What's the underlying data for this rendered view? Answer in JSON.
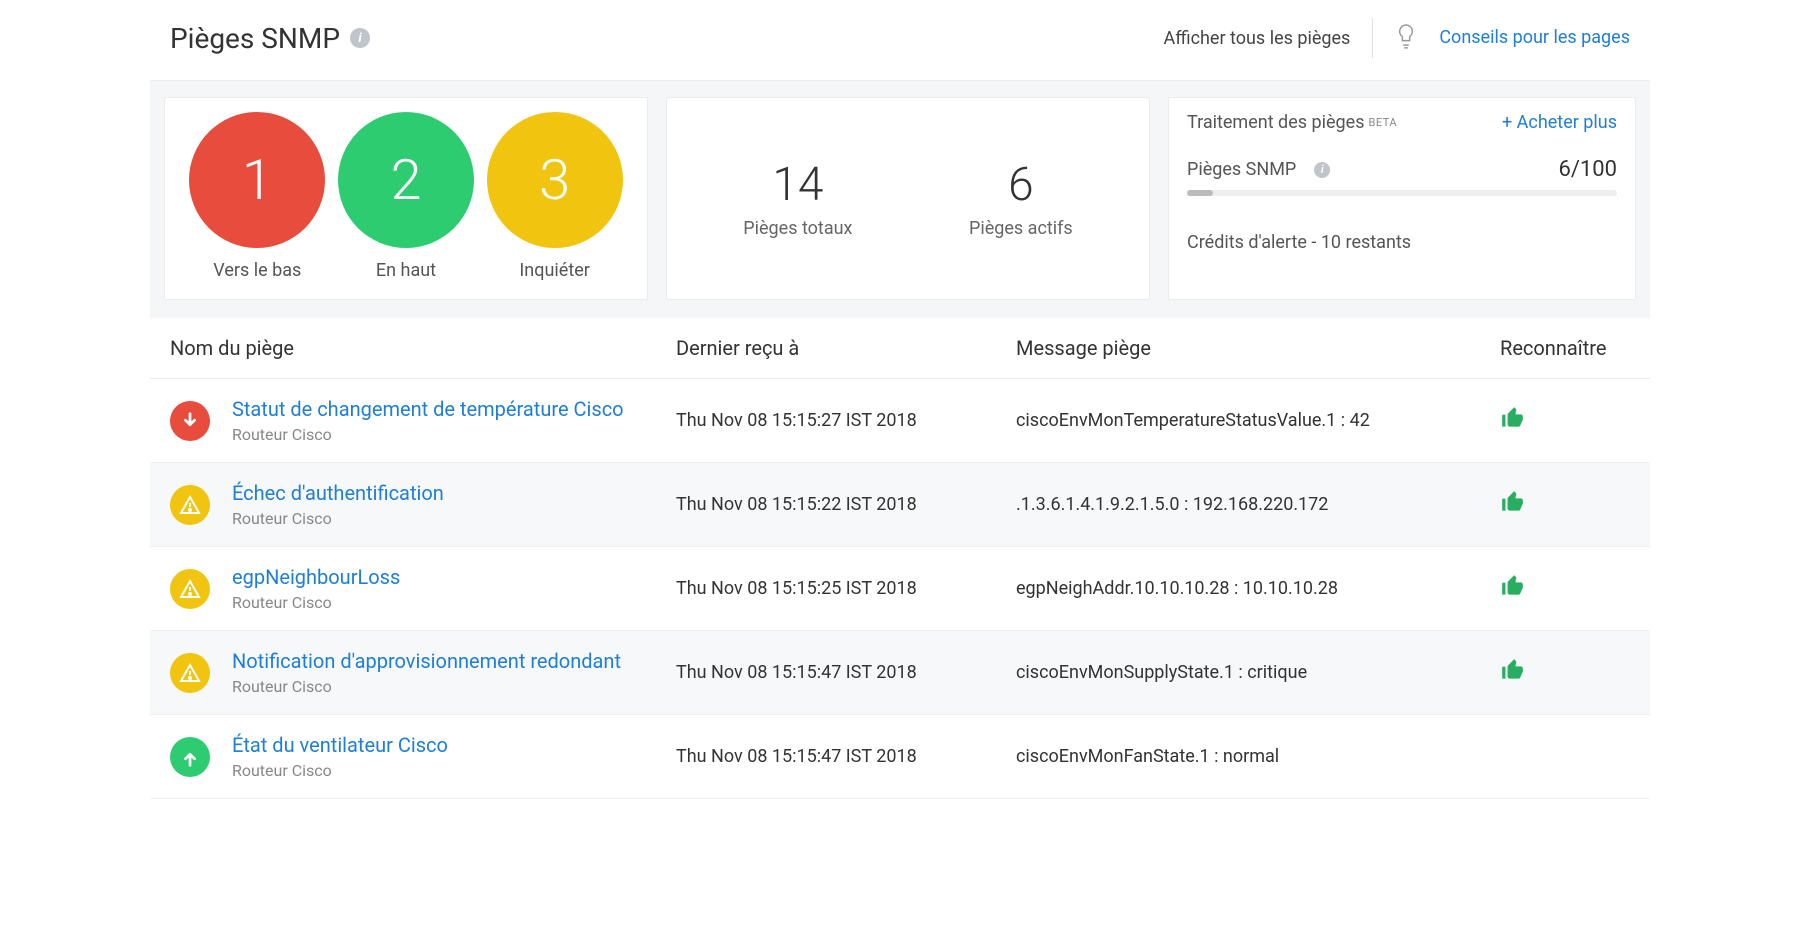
{
  "header": {
    "title": "Pièges SNMP",
    "show_all": "Afficher tous les pièges",
    "tips": "Conseils pour les pages"
  },
  "status_summary": [
    {
      "count": "1",
      "label": "Vers le bas",
      "color": "red"
    },
    {
      "count": "2",
      "label": "En haut",
      "color": "green"
    },
    {
      "count": "3",
      "label": "Inquiéter",
      "color": "yellow"
    }
  ],
  "totals": {
    "total_num": "14",
    "total_lbl": "Pièges totaux",
    "active_num": "6",
    "active_lbl": "Pièges actifs"
  },
  "quota": {
    "title": "Traitement des pièges",
    "beta": "BETA",
    "buy": "+ Acheter plus",
    "metric_label": "Pièges SNMP",
    "metric_value": "6/100",
    "credits": "Crédits d'alerte - 10 restants"
  },
  "columns": {
    "name": "Nom du piège",
    "time": "Dernier reçu à",
    "msg": "Message piège",
    "ack": "Reconnaître"
  },
  "traps": [
    {
      "status": "down",
      "name": "Statut de changement de température Cisco",
      "device": "Routeur Cisco",
      "time": "Thu Nov 08 15:15:27 IST 2018",
      "msg": "ciscoEnvMonTemperatureStatusValue.1 : 42",
      "ack": true,
      "alt": false
    },
    {
      "status": "warn",
      "name": "Échec d'authentification",
      "device": "Routeur Cisco",
      "time": "Thu Nov 08 15:15:22 IST 2018",
      "msg": ".1.3.6.1.4.1.9.2.1.5.0 : 192.168.220.172",
      "ack": true,
      "alt": true
    },
    {
      "status": "warn",
      "name": "egpNeighbourLoss",
      "device": "Routeur Cisco",
      "time": "Thu Nov 08 15:15:25 IST 2018",
      "msg": "egpNeighAddr.10.10.10.28 : 10.10.10.28",
      "ack": true,
      "alt": false
    },
    {
      "status": "warn",
      "name": "Notification d'approvisionnement redondant",
      "device": "Routeur Cisco",
      "time": "Thu Nov 08 15:15:47 IST 2018",
      "msg": "ciscoEnvMonSupplyState.1 : critique",
      "ack": true,
      "alt": true
    },
    {
      "status": "up",
      "name": "État du ventilateur Cisco",
      "device": "Routeur Cisco",
      "time": "Thu Nov 08 15:15:47 IST 2018",
      "msg": "ciscoEnvMonFanState.1 : normal",
      "ack": false,
      "alt": false
    }
  ]
}
